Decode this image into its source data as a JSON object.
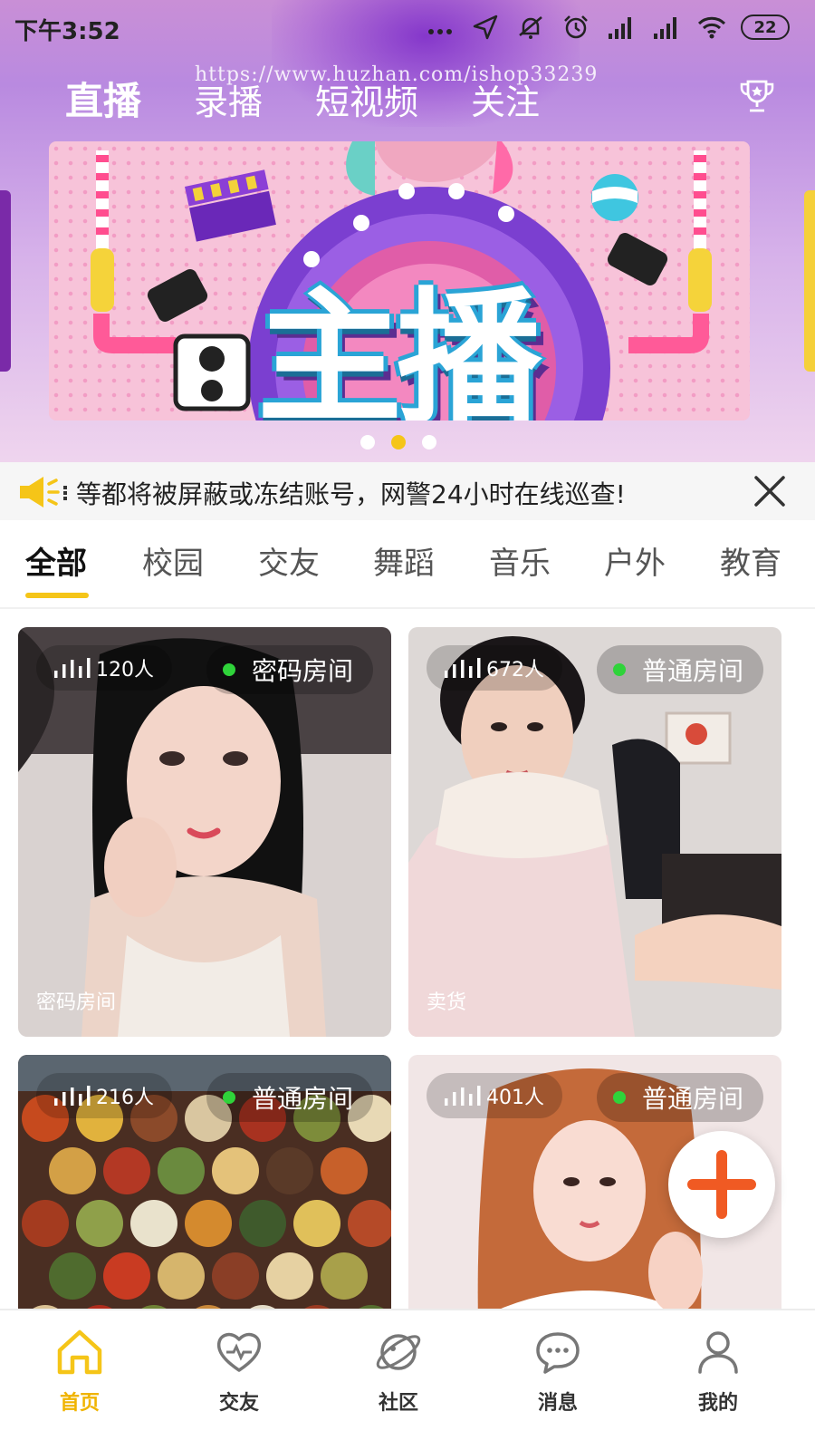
{
  "status_bar": {
    "time": "下午3:52",
    "battery": "22"
  },
  "watermark": "https://www.huzhan.com/ishop33239",
  "top_tabs": [
    {
      "label": "直播",
      "active": true
    },
    {
      "label": "录播"
    },
    {
      "label": "短视频"
    },
    {
      "label": "关注"
    }
  ],
  "banner": {
    "title": "主播",
    "slide_count": 3,
    "active_slide": 1
  },
  "notice": {
    "text": "等都将被屏蔽或冻结账号，网警24小时在线巡查!"
  },
  "categories": [
    {
      "label": "全部",
      "active": true
    },
    {
      "label": "校园"
    },
    {
      "label": "交友"
    },
    {
      "label": "舞蹈"
    },
    {
      "label": "音乐"
    },
    {
      "label": "户外"
    },
    {
      "label": "教育"
    }
  ],
  "rooms": [
    {
      "viewers": "120人",
      "tag": "密码房间",
      "caption": "密码房间"
    },
    {
      "viewers": "672人",
      "tag": "普通房间",
      "caption": "卖货"
    },
    {
      "viewers": "216人",
      "tag": "普通房间",
      "caption": ""
    },
    {
      "viewers": "401人",
      "tag": "普通房间",
      "caption": ""
    }
  ],
  "bottom_nav": [
    {
      "label": "首页",
      "icon": "home-icon",
      "active": true
    },
    {
      "label": "交友",
      "icon": "heart-pulse-icon"
    },
    {
      "label": "社区",
      "icon": "planet-icon"
    },
    {
      "label": "消息",
      "icon": "chat-icon"
    },
    {
      "label": "我的",
      "icon": "user-icon"
    }
  ],
  "colors": {
    "accent": "#f5c518",
    "fab_plus": "#f05a23",
    "online_dot": "#2fd33a"
  }
}
